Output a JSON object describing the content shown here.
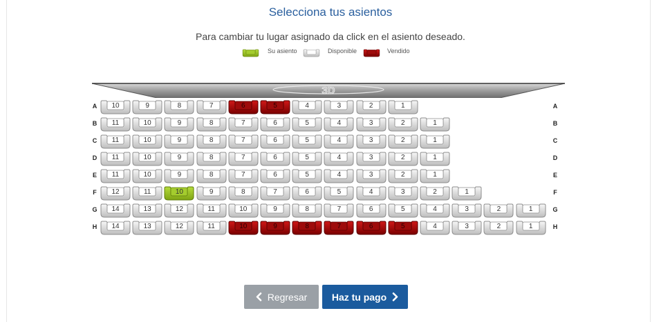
{
  "header": {
    "title": "Selecciona tus asientos",
    "instructions": "Para cambiar tu lugar asignado da click en el asiento deseado."
  },
  "legend": {
    "selected": "Su asiento",
    "available": "Disponible",
    "sold": "Vendido"
  },
  "colors": {
    "title": "#2a5f9e",
    "selected": "#9bc427",
    "available": "#e6e6e6",
    "sold": "#b00f10",
    "back_button": "#9aa0a6",
    "pay_button": "#1b5b9e"
  },
  "screen": {
    "icon": "screen-3d-icon"
  },
  "seatmap": {
    "rows": [
      {
        "label": "A",
        "seats": [
          {
            "n": "10",
            "s": "available"
          },
          {
            "n": "9",
            "s": "available"
          },
          {
            "n": "8",
            "s": "available"
          },
          {
            "n": "7",
            "s": "available"
          },
          {
            "n": "6",
            "s": "sold"
          },
          {
            "n": "5",
            "s": "sold"
          },
          {
            "n": "4",
            "s": "available"
          },
          {
            "n": "3",
            "s": "available"
          },
          {
            "n": "2",
            "s": "available"
          },
          {
            "n": "1",
            "s": "available"
          }
        ]
      },
      {
        "label": "B",
        "seats": [
          {
            "n": "11",
            "s": "available"
          },
          {
            "n": "10",
            "s": "available"
          },
          {
            "n": "9",
            "s": "available"
          },
          {
            "n": "8",
            "s": "available"
          },
          {
            "n": "7",
            "s": "available"
          },
          {
            "n": "6",
            "s": "available"
          },
          {
            "n": "5",
            "s": "available"
          },
          {
            "n": "4",
            "s": "available"
          },
          {
            "n": "3",
            "s": "available"
          },
          {
            "n": "2",
            "s": "available"
          },
          {
            "n": "1",
            "s": "available"
          }
        ]
      },
      {
        "label": "C",
        "seats": [
          {
            "n": "11",
            "s": "available"
          },
          {
            "n": "10",
            "s": "available"
          },
          {
            "n": "9",
            "s": "available"
          },
          {
            "n": "8",
            "s": "available"
          },
          {
            "n": "7",
            "s": "available"
          },
          {
            "n": "6",
            "s": "available"
          },
          {
            "n": "5",
            "s": "available"
          },
          {
            "n": "4",
            "s": "available"
          },
          {
            "n": "3",
            "s": "available"
          },
          {
            "n": "2",
            "s": "available"
          },
          {
            "n": "1",
            "s": "available"
          }
        ]
      },
      {
        "label": "D",
        "seats": [
          {
            "n": "11",
            "s": "available"
          },
          {
            "n": "10",
            "s": "available"
          },
          {
            "n": "9",
            "s": "available"
          },
          {
            "n": "8",
            "s": "available"
          },
          {
            "n": "7",
            "s": "available"
          },
          {
            "n": "6",
            "s": "available"
          },
          {
            "n": "5",
            "s": "available"
          },
          {
            "n": "4",
            "s": "available"
          },
          {
            "n": "3",
            "s": "available"
          },
          {
            "n": "2",
            "s": "available"
          },
          {
            "n": "1",
            "s": "available"
          }
        ]
      },
      {
        "label": "E",
        "seats": [
          {
            "n": "11",
            "s": "available"
          },
          {
            "n": "10",
            "s": "available"
          },
          {
            "n": "9",
            "s": "available"
          },
          {
            "n": "8",
            "s": "available"
          },
          {
            "n": "7",
            "s": "available"
          },
          {
            "n": "6",
            "s": "available"
          },
          {
            "n": "5",
            "s": "available"
          },
          {
            "n": "4",
            "s": "available"
          },
          {
            "n": "3",
            "s": "available"
          },
          {
            "n": "2",
            "s": "available"
          },
          {
            "n": "1",
            "s": "available"
          }
        ]
      },
      {
        "label": "F",
        "seats": [
          {
            "n": "12",
            "s": "available"
          },
          {
            "n": "11",
            "s": "available"
          },
          {
            "n": "10",
            "s": "selected"
          },
          {
            "n": "9",
            "s": "available"
          },
          {
            "n": "8",
            "s": "available"
          },
          {
            "n": "7",
            "s": "available"
          },
          {
            "n": "6",
            "s": "available"
          },
          {
            "n": "5",
            "s": "available"
          },
          {
            "n": "4",
            "s": "available"
          },
          {
            "n": "3",
            "s": "available"
          },
          {
            "n": "2",
            "s": "available"
          },
          {
            "n": "1",
            "s": "available"
          }
        ]
      },
      {
        "label": "G",
        "seats": [
          {
            "n": "14",
            "s": "available"
          },
          {
            "n": "13",
            "s": "available"
          },
          {
            "n": "12",
            "s": "available"
          },
          {
            "n": "11",
            "s": "available"
          },
          {
            "n": "10",
            "s": "available"
          },
          {
            "n": "9",
            "s": "available"
          },
          {
            "n": "8",
            "s": "available"
          },
          {
            "n": "7",
            "s": "available"
          },
          {
            "n": "6",
            "s": "available"
          },
          {
            "n": "5",
            "s": "available"
          },
          {
            "n": "4",
            "s": "available"
          },
          {
            "n": "3",
            "s": "available"
          },
          {
            "n": "2",
            "s": "available"
          },
          {
            "n": "1",
            "s": "available"
          }
        ]
      },
      {
        "label": "H",
        "seats": [
          {
            "n": "14",
            "s": "available"
          },
          {
            "n": "13",
            "s": "available"
          },
          {
            "n": "12",
            "s": "available"
          },
          {
            "n": "11",
            "s": "available"
          },
          {
            "n": "10",
            "s": "sold"
          },
          {
            "n": "9",
            "s": "sold"
          },
          {
            "n": "8",
            "s": "sold"
          },
          {
            "n": "7",
            "s": "sold"
          },
          {
            "n": "6",
            "s": "sold"
          },
          {
            "n": "5",
            "s": "sold"
          },
          {
            "n": "4",
            "s": "available"
          },
          {
            "n": "3",
            "s": "available"
          },
          {
            "n": "2",
            "s": "available"
          },
          {
            "n": "1",
            "s": "available"
          }
        ]
      }
    ]
  },
  "buttons": {
    "back_label": "Regresar",
    "back_icon": "chevron-left-icon",
    "pay_label": "Haz tu pago",
    "pay_icon": "chevron-right-icon"
  }
}
